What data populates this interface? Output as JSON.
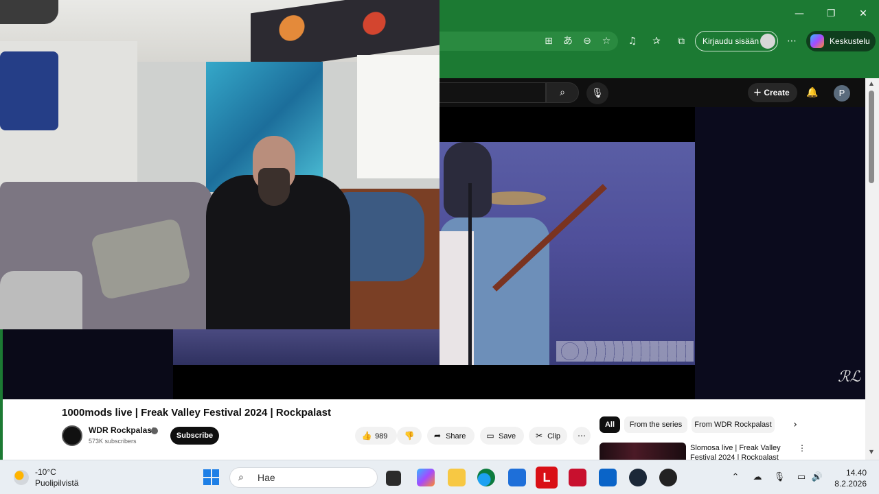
{
  "browser": {
    "signin_label": "Kirjaudu sisään",
    "copilot_label": "Keskustelu",
    "window_buttons": [
      "—",
      "❐",
      "✕"
    ],
    "toolbar_icons": [
      "apps-icon",
      "translate-icon",
      "zoom-out-icon",
      "favorite-star-icon",
      "media-icon",
      "favorites-icon",
      "collections-icon",
      "more-icon"
    ]
  },
  "youtube": {
    "create_label": "Create",
    "avatar_letter": "P",
    "video": {
      "title": "1000mods live | Freak Valley Festival 2024 | Rockpalast",
      "channel": "WDR Rockpalast",
      "subscribers": "573K subscribers",
      "subscribe_label": "Subscribe",
      "likes": "989",
      "share_label": "Share",
      "save_label": "Save",
      "clip_label": "Clip"
    },
    "chips": [
      "All",
      "From the series",
      "From WDR Rockpalast"
    ],
    "recommendation": {
      "title": "Slomosa live | Freak Valley Festival 2024 | Rockpalast"
    },
    "watermark": "ℛℒ"
  },
  "taskbar": {
    "temperature": "-10°C",
    "condition": "Puolipilvistä",
    "search_placeholder": "Hae",
    "time": "14.40",
    "date": "8.2.2026"
  },
  "colors": {
    "browser_green": "#1c7a33",
    "youtube_dark": "#0f0f0f",
    "taskbar": "#e9eef3"
  }
}
